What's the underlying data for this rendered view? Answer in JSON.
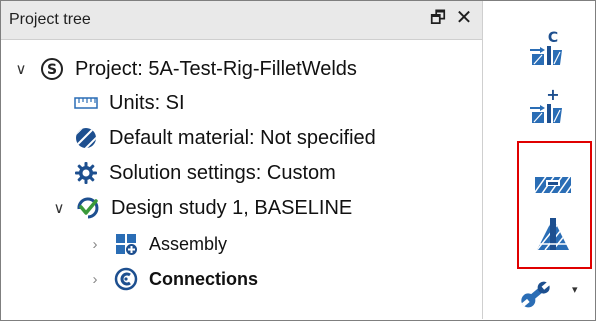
{
  "panel": {
    "title": "Project tree",
    "pin_glyph": "🗗",
    "close_glyph": "✕"
  },
  "tree": {
    "project_label": "Project: 5A-Test-Rig-FilletWelds",
    "units_label": "Units: SI",
    "material_label": "Default material: Not specified",
    "solution_label": "Solution settings: Custom",
    "study_label": "Design study 1, BASELINE",
    "assembly_label": "Assembly",
    "connections_label": "Connections",
    "expanded_glyph": "∨",
    "collapsed_glyph": "›"
  },
  "toolbar": {
    "buttons": [
      {
        "icon": "copy-connection-icon",
        "glyph": "C"
      },
      {
        "icon": "add-connection-icon",
        "glyph": "+"
      },
      {
        "icon": "plate-weld-icon"
      },
      {
        "icon": "fillet-weld-icon"
      },
      {
        "icon": "wrench-icon"
      }
    ],
    "dropdown_glyph": "▾"
  },
  "colors": {
    "icon_blue": "#2a6db5",
    "icon_dark": "#1d4f8f",
    "icon_green": "#3a9a3a",
    "highlight": "#e00000"
  }
}
